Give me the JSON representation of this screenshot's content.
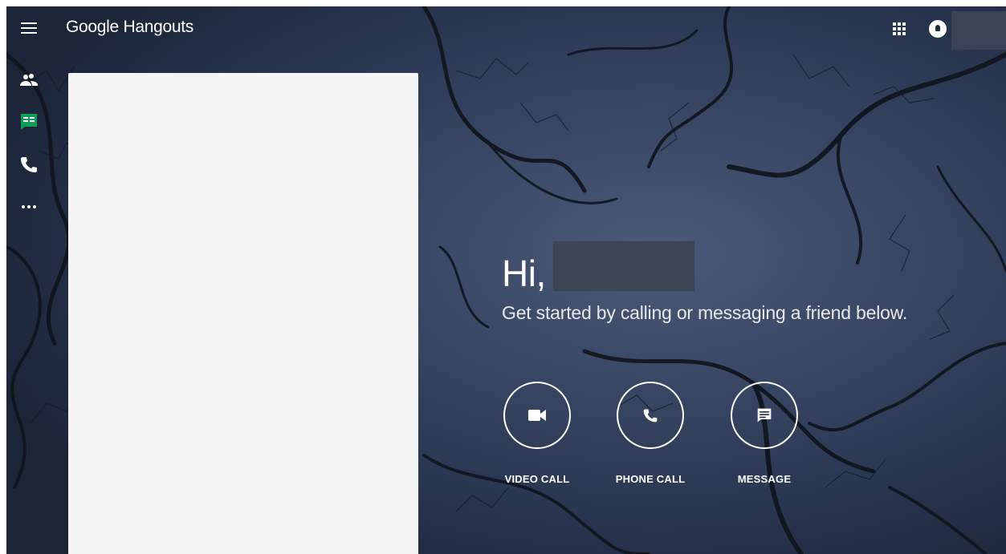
{
  "header": {
    "menu_icon": "hamburger-menu-icon",
    "app_title": "Google Hangouts",
    "apps_icon": "apps-grid-icon",
    "notifications_icon": "notifications-bell-icon"
  },
  "sidebar": {
    "items": [
      {
        "icon": "contacts-icon",
        "active": false
      },
      {
        "icon": "conversations-icon",
        "active": true,
        "color": "#0f9d58"
      },
      {
        "icon": "phone-icon",
        "active": false
      },
      {
        "icon": "more-horiz-icon",
        "active": false
      }
    ]
  },
  "main": {
    "greeting": "Hi,",
    "subtitle": "Get started by calling or messaging a friend below.",
    "actions": [
      {
        "label": "VIDEO CALL",
        "icon": "videocam-icon"
      },
      {
        "label": "PHONE CALL",
        "icon": "phone-icon"
      },
      {
        "label": "MESSAGE",
        "icon": "message-icon"
      }
    ]
  },
  "colors": {
    "background": "#26324a",
    "panel": "#f5f5f5",
    "accent_green": "#0f9d58"
  }
}
